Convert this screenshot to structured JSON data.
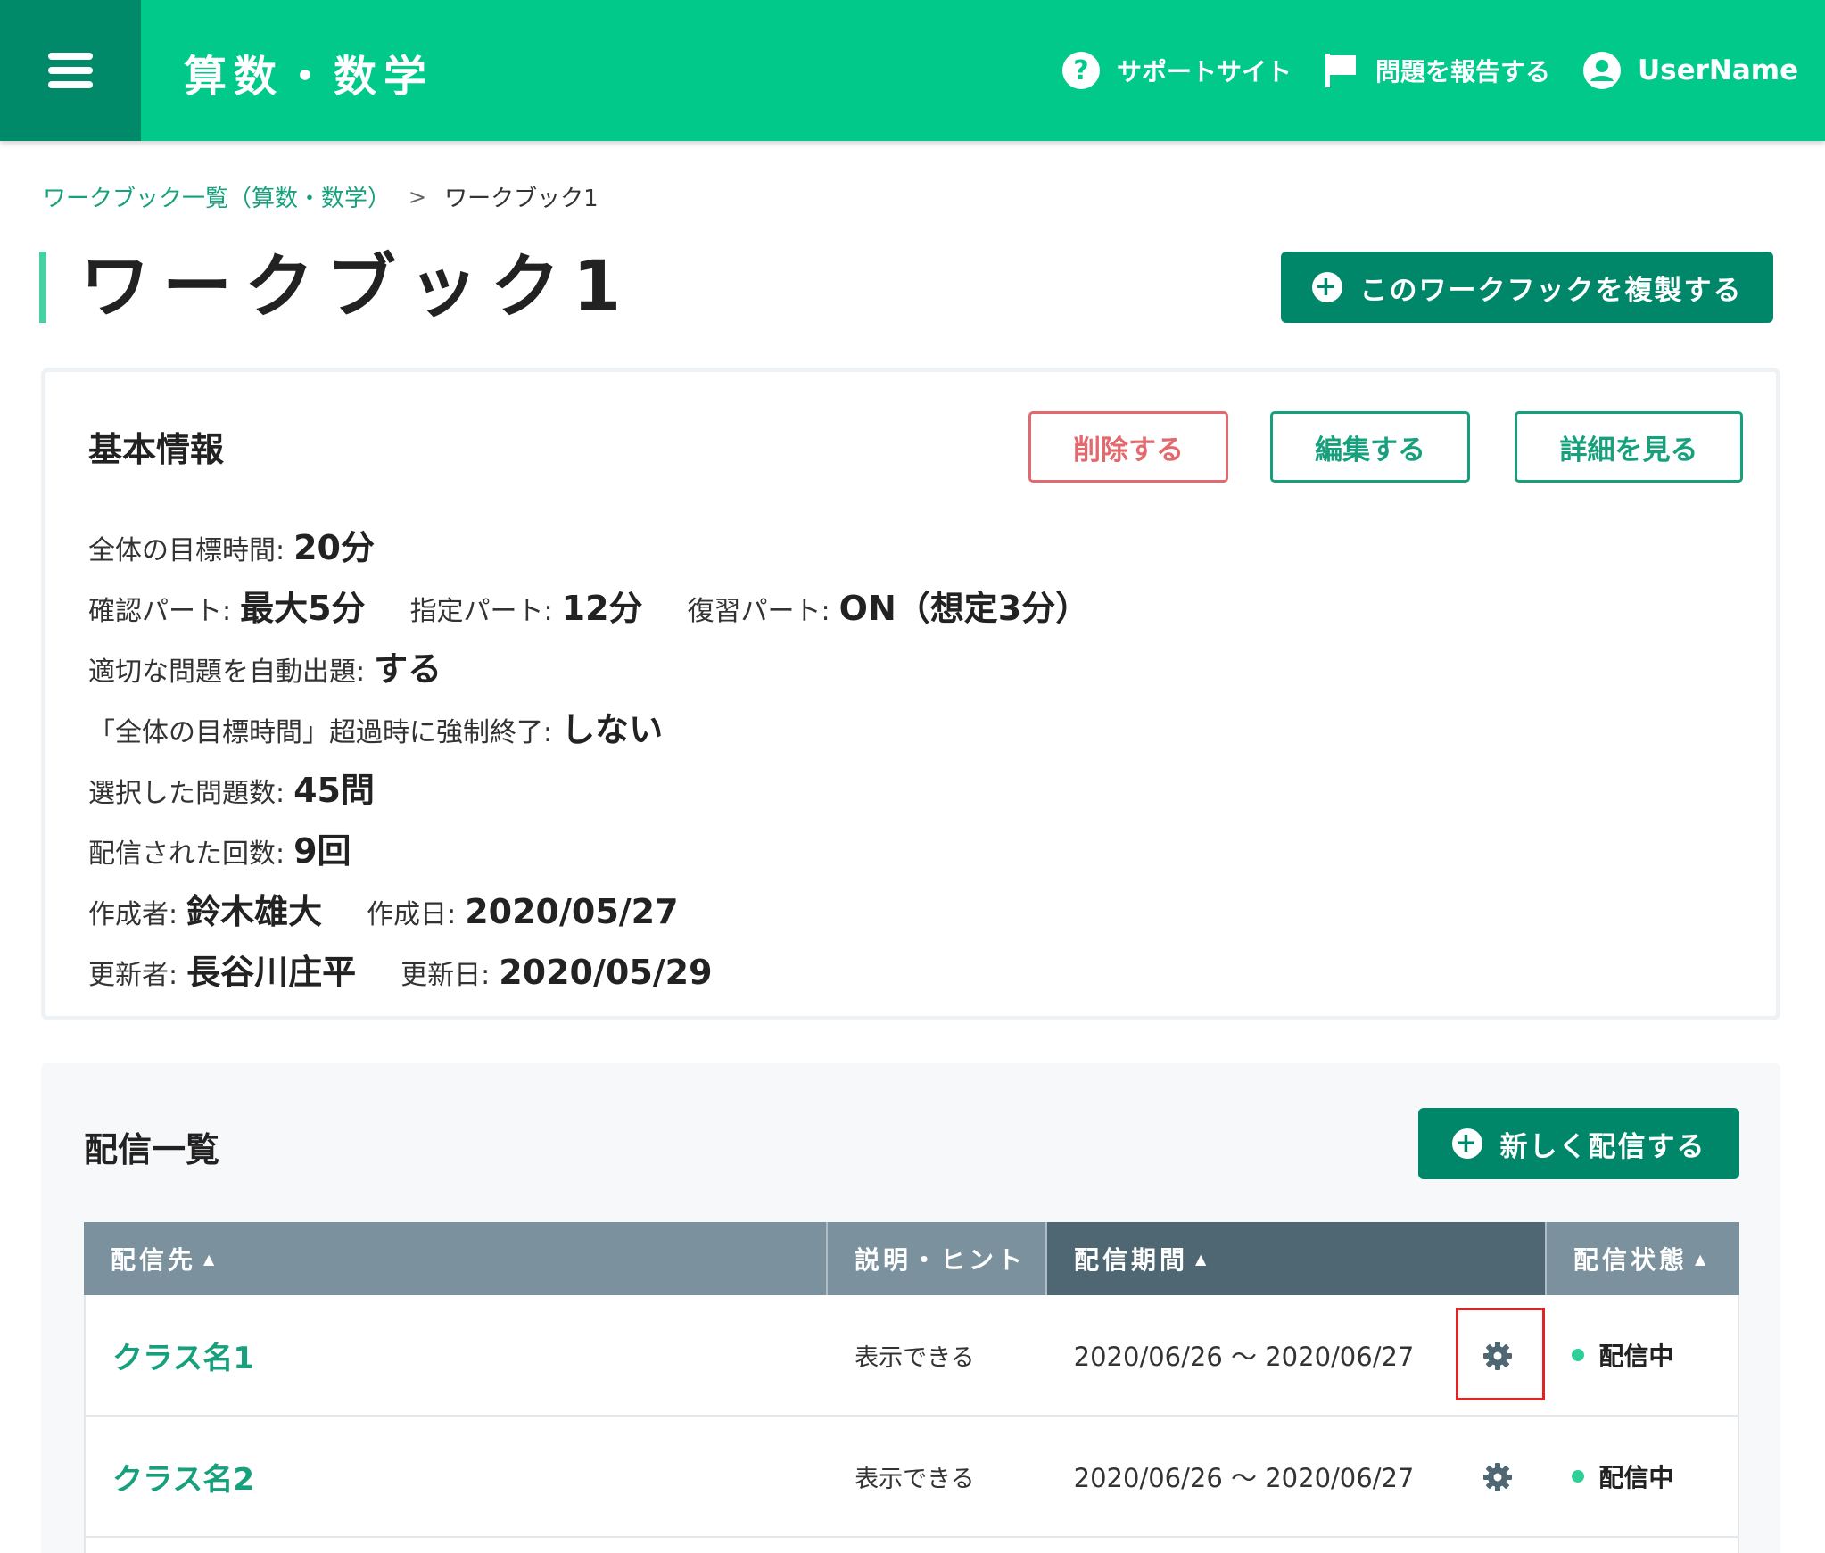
{
  "header": {
    "app_title": "算数・数学",
    "help_label": "サポートサイト",
    "report_label": "問題を報告する",
    "user_label": "UserName"
  },
  "breadcrumb": {
    "parent": "ワークブック一覧（算数・数学）",
    "separator": ">",
    "current": "ワークブック1"
  },
  "page": {
    "title": "ワークブック1",
    "duplicate_label": "このワークフックを複製する"
  },
  "info": {
    "heading": "基本情報",
    "delete_label": "削除する",
    "edit_label": "編集する",
    "detail_label": "詳細を見る",
    "target_time_label": "全体の目標時間:",
    "target_time_value": "20分",
    "confirm_part_label": "確認パート:",
    "confirm_part_value": "最大5分",
    "assigned_part_label": "指定パート:",
    "assigned_part_value": "12分",
    "review_part_label": "復習パート:",
    "review_part_value": "ON（想定3分）",
    "auto_question_label": "適切な問題を自動出題:",
    "auto_question_value": "する",
    "force_end_label": "「全体の目標時間」超過時に強制終了:",
    "force_end_value": "しない",
    "selected_count_label": "選択した問題数:",
    "selected_count_value": "45問",
    "delivered_count_label": "配信された回数:",
    "delivered_count_value": "9回",
    "creator_label": "作成者:",
    "creator_value": "鈴木雄大",
    "created_date_label": "作成日:",
    "created_date_value": "2020/05/27",
    "updater_label": "更新者:",
    "updater_value": "長谷川庄平",
    "updated_date_label": "更新日:",
    "updated_date_value": "2020/05/29"
  },
  "delivery": {
    "heading": "配信一覧",
    "new_label": "新しく配信する",
    "columns": [
      "配信先",
      "説明・ヒント",
      "配信期間",
      "配信状態"
    ],
    "rows": [
      {
        "class_name": "クラス名1",
        "hint": "表示できる",
        "period": "2020/06/26 〜 2020/06/27",
        "status": "配信中"
      },
      {
        "class_name": "クラス名2",
        "hint": "表示できる",
        "period": "2020/06/26 〜 2020/06/27",
        "status": "配信中"
      }
    ]
  },
  "colors": {
    "header_green": "#00c98a",
    "dark_green": "#00876a",
    "link_green": "#16a07c",
    "delete_red": "#e26a6f",
    "table_header": "#7b929e",
    "table_header_active": "#4f6772",
    "highlight_red": "#e02424"
  },
  "icons": {
    "menu": "hamburger-icon",
    "help": "question-circle-icon",
    "report": "flag-icon",
    "user": "user-circle-icon",
    "add": "plus-circle-icon",
    "settings": "gear-icon",
    "sort": "caret-up-icon",
    "status": "status-dot-icon"
  }
}
